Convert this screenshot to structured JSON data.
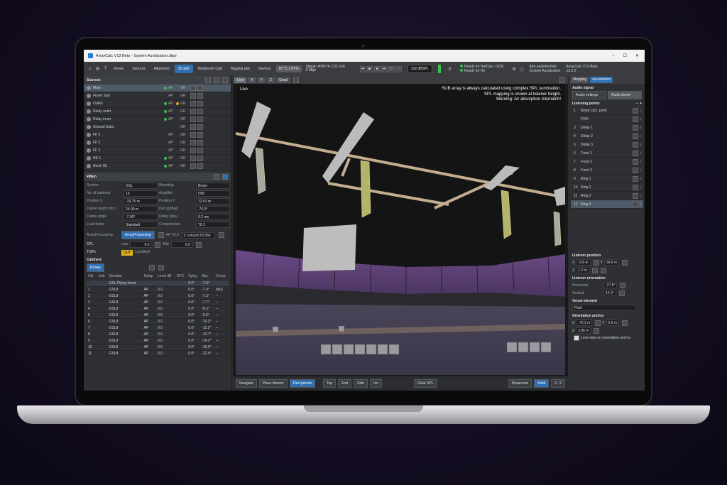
{
  "window": {
    "title": "ArrayCalc V13 Beta - System Auralization.dbpr",
    "controls": [
      "–",
      "☐",
      "✕"
    ]
  },
  "menu": {
    "tabs": [
      "Venue",
      "Sources",
      "Alignment",
      "3D plot",
      "Headroom Calc",
      "Rigging plot",
      "Devices"
    ],
    "active_tab": "3D plot",
    "temperature": "20 °C | 70 %",
    "signal_line1": "Signal: 4096 Hz (1/1 oct)",
    "signal_line2": "0 dBpi",
    "db_display": "132 dBSPL",
    "status_line1": "Ready for NetCalc / SOE",
    "status_line2": "Ready for R1",
    "right_line1": "d&b audiotechnik",
    "right_line2": "System Auralization",
    "version": "ArrayCalc V13 Beta",
    "build": "13.0.0"
  },
  "sources": {
    "title": "Sources",
    "items": [
      {
        "name": "Main",
        "ap": "AP",
        "gr": "GR",
        "ap_on": true,
        "gr_on": false,
        "selected": true
      },
      {
        "name": "Flown Sub",
        "ap": "AP",
        "gr": "GR",
        "ap_on": false,
        "gr_on": false
      },
      {
        "name": "OutEll",
        "ap": "AP",
        "gr": "GR",
        "ap_on": true,
        "gr_on": true
      },
      {
        "name": "Delay outer",
        "ap": "AP",
        "gr": "GR",
        "ap_on": true,
        "gr_on": false
      },
      {
        "name": "Delay inner",
        "ap": "AP",
        "gr": "GR",
        "ap_on": true,
        "gr_on": false
      },
      {
        "name": "Ground Subs",
        "ap": "",
        "gr": "GR",
        "ap_on": false,
        "gr_on": false
      },
      {
        "name": "FF 2",
        "ap": "AP",
        "gr": "GR",
        "ap_on": false,
        "gr_on": false
      },
      {
        "name": "FF 2",
        "ap": "AP",
        "gr": "GR",
        "ap_on": false,
        "gr_on": false
      },
      {
        "name": "FF 3",
        "ap": "AP",
        "gr": "GR",
        "ap_on": false,
        "gr_on": false
      },
      {
        "name": "NE 1",
        "ap": "AP",
        "gr": "GR",
        "ap_on": true,
        "gr_on": false
      },
      {
        "name": "North Clt",
        "ap": "AP",
        "gr": "GR",
        "ap_on": true,
        "gr_on": false
      }
    ]
  },
  "main": {
    "title": "Main",
    "fields": [
      [
        "System",
        "GSL",
        "Mounting",
        "Beam"
      ],
      [
        "No. of cabinets",
        "16",
        "Amplifier",
        "D80"
      ],
      [
        "Position X",
        "-19.75 m",
        "Position Y",
        "12.63 m"
      ],
      [
        "Frame height (bot.)",
        "24.00 m",
        "Pan (global)",
        "-70.0°"
      ],
      [
        "Frame angle",
        "-7.00°",
        "Delay (abs.)",
        "6.2 ms"
      ],
      [
        "Load factor",
        "Standard",
        "Compression",
        "70.1"
      ]
    ],
    "array_processing_label": "ArrayProcessing",
    "array_processing_button": "ArrayProcessing",
    "ap_version": "AP V2.0",
    "ap_mode": "1: concert 23.06h",
    "cpl_label": "CPL",
    "cpl_line": "Line",
    "cpl_line_val": "0.0",
    "cpl_mid": "Mid",
    "cpl_mid_val": "0.0",
    "tops_label": "TOPs",
    "tops_badge": "CUT",
    "tops_sub": "LowShelf",
    "cabinets_label": "Cabinets",
    "rotate_label": "Rotate"
  },
  "cabinets": {
    "headers": [
      "Util.",
      "Link",
      "Speaker",
      "Setup",
      "Level dB",
      "HFC",
      "Splay",
      "Abs.",
      "Comp"
    ],
    "pickup": "GSL Flying frame",
    "pickup_splay": "0.0°",
    "pickup_abs": "-7.0°",
    "rows": [
      {
        "n": "1",
        "spk": "GSL8",
        "setup": "AP",
        "lvl": "0.0",
        "splay": "0.0°",
        "abs": "-7.0°",
        "comp": "NoS"
      },
      {
        "n": "2",
        "spk": "GSL8",
        "setup": "AP",
        "lvl": "0.0",
        "splay": "0.0°",
        "abs": "-7.3°",
        "comp": "–"
      },
      {
        "n": "3",
        "spk": "GSL8",
        "setup": "AP",
        "lvl": "0.0",
        "splay": "0.0°",
        "abs": "-7.7°",
        "comp": "–"
      },
      {
        "n": "4",
        "spk": "GSL8",
        "setup": "AP",
        "lvl": "0.0",
        "splay": "0.0°",
        "abs": "-8.3°",
        "comp": "–"
      },
      {
        "n": "5",
        "spk": "GSL8",
        "setup": "AP",
        "lvl": "0.0",
        "splay": "0.0°",
        "abs": "-9.3°",
        "comp": "–"
      },
      {
        "n": "6",
        "spk": "GSL8",
        "setup": "AP",
        "lvl": "0.0",
        "splay": "0.0°",
        "abs": "-10.2°",
        "comp": "–"
      },
      {
        "n": "7",
        "spk": "GSL8",
        "setup": "AP",
        "lvl": "0.0",
        "splay": "0.0°",
        "abs": "-11.2°",
        "comp": "–"
      },
      {
        "n": "8",
        "spk": "GSL8",
        "setup": "AP",
        "lvl": "0.0",
        "splay": "0.0°",
        "abs": "-12.7°",
        "comp": "–"
      },
      {
        "n": "9",
        "spk": "GSL8",
        "setup": "AP",
        "lvl": "0.0",
        "splay": "0.0°",
        "abs": "-14.2°",
        "comp": "–"
      },
      {
        "n": "10",
        "spk": "GSL8",
        "setup": "AP",
        "lvl": "0.0",
        "splay": "0.0°",
        "abs": "-16.2°",
        "comp": "–"
      },
      {
        "n": "11",
        "spk": "GSL8",
        "setup": "AP",
        "lvl": "0.0",
        "splay": "0.0°",
        "abs": "-22.4°",
        "comp": "–"
      }
    ]
  },
  "viewport": {
    "tabs": [
      "Live",
      "X",
      "Y",
      "Z",
      "Quad"
    ],
    "live_tag": "Live",
    "overlay_line1": "SUB array is always calculated using complex SPL summation.",
    "overlay_line2": "SPL mapping is shown at listener height.",
    "overlay_line3": "Warning: Air absorption mismatch!",
    "bottom_buttons": [
      "Navigate",
      "Place listener",
      "First person",
      "Top",
      "End",
      "Side",
      "Iso"
    ],
    "active_bottom": "First person",
    "clear_spl": "Clear SPL",
    "dispersion": "Dispersion",
    "solid": "Solid",
    "scale": "0 : 2"
  },
  "right": {
    "tabs": [
      "Mapping",
      "Auralization"
    ],
    "active_tab": "Auralization",
    "audio_signal": "Audio signal",
    "audio_settings": "Audio settings",
    "audio_player": "Audio player",
    "listening_points": "Listening points",
    "points": [
      {
        "n": "1",
        "name": "Noise calc. point"
      },
      {
        "n": "",
        "name": "FOH"
      },
      {
        "n": "3",
        "name": "Delay 1"
      },
      {
        "n": "4",
        "name": "Delay 2"
      },
      {
        "n": "5",
        "name": "Delay 3"
      },
      {
        "n": "6",
        "name": "Front 1"
      },
      {
        "n": "7",
        "name": "Front 2"
      },
      {
        "n": "8",
        "name": "Front 3"
      },
      {
        "n": "9",
        "name": "Ring 1"
      },
      {
        "n": "10",
        "name": "Ring 2"
      },
      {
        "n": "11",
        "name": "Ring 3"
      },
      {
        "n": "12",
        "name": "Ring 4"
      }
    ],
    "selected_point": 11,
    "listener_position": "Listener position",
    "pos_x_label": "X",
    "pos_x": "-9.8 m",
    "pos_y_label": "Y",
    "pos_y": "34.8 m",
    "pos_z_label": "Z",
    "pos_z": "1.2 m",
    "listener_orientation": "Listener orientation",
    "horizontal_label": "Horizontal",
    "horizontal": "-27.8°",
    "vertical_label": "Vertical",
    "vertical": "14.9°",
    "venue_element": "Venue element",
    "venue_value": "Pitch",
    "orientation_anchor": "Orientation anchor",
    "anchor_x_label": "X",
    "anchor_x": "-70.3 m",
    "anchor_y_label": "Y",
    "anchor_y": "0.0 m",
    "anchor_z_label": "Z",
    "anchor_z": "2.86 m",
    "lock_label": "Lock view on orientation anchor"
  }
}
